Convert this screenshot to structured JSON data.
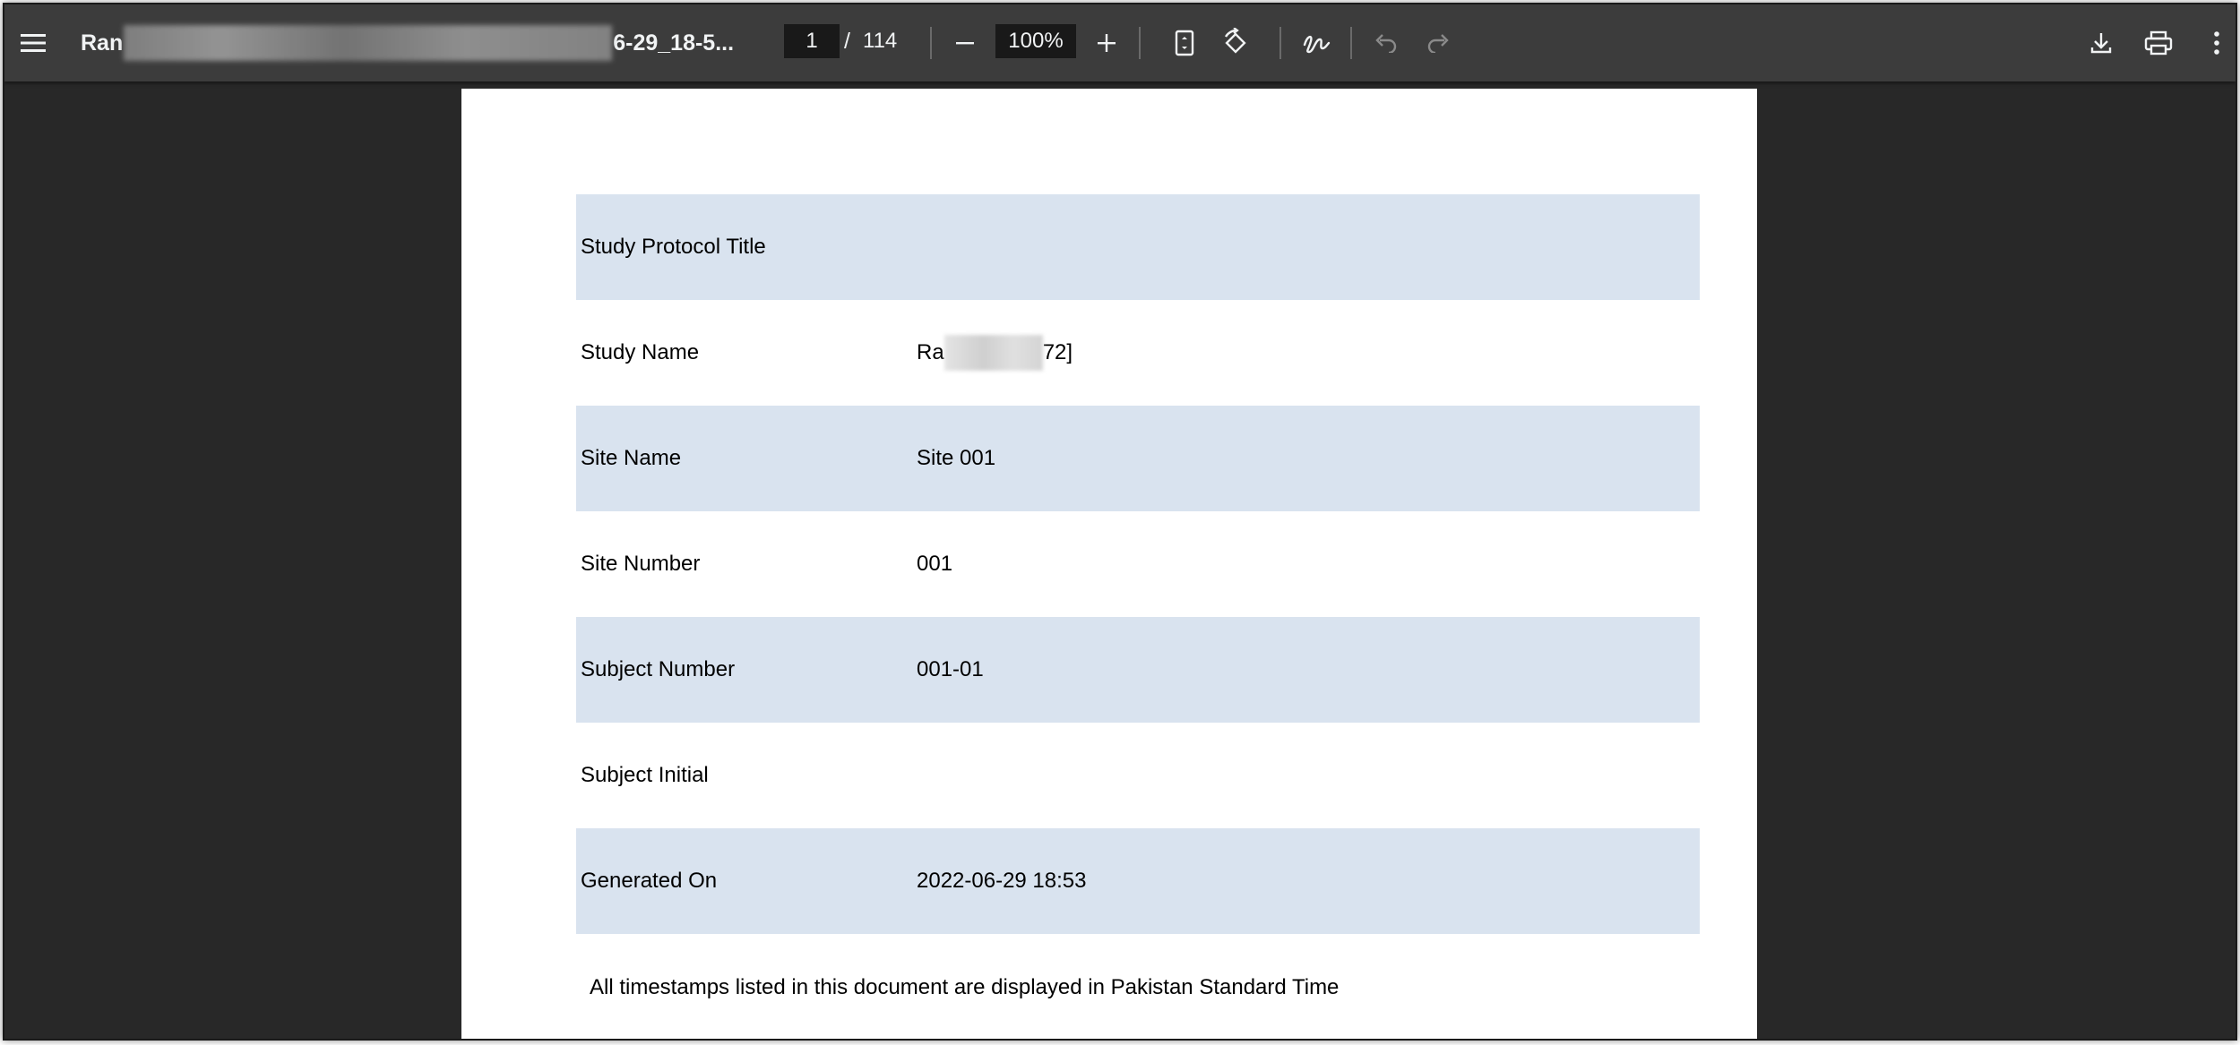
{
  "toolbar": {
    "menu_icon": "hamburger-menu-icon",
    "file_title_prefix": "Ran",
    "file_title_suffix": "6-29_18-5...",
    "current_page": "1",
    "page_separator": "/",
    "total_pages": "114",
    "zoom_out_icon": "minus-icon",
    "zoom_level": "100%",
    "zoom_in_icon": "plus-icon",
    "fit_page_icon": "fit-to-page-icon",
    "rotate_icon": "rotate-icon",
    "annotate_icon": "draw-annotation-icon",
    "undo_icon": "undo-icon",
    "redo_icon": "redo-icon",
    "download_icon": "download-icon",
    "print_icon": "print-icon",
    "more_icon": "more-vertical-icon"
  },
  "document": {
    "rows": [
      {
        "label": "Study Protocol Title",
        "value": "",
        "shaded": true
      },
      {
        "label": "Study Name",
        "value_prefix": "Ra",
        "value_suffix": "72]",
        "redacted": true,
        "shaded": false
      },
      {
        "label": "Site Name",
        "value": "Site 001",
        "shaded": true
      },
      {
        "label": "Site Number",
        "value": "001",
        "shaded": false
      },
      {
        "label": "Subject Number",
        "value": "001-01",
        "shaded": true
      },
      {
        "label": "Subject Initial",
        "value": "",
        "shaded": false
      },
      {
        "label": "Generated On",
        "value": "2022-06-29 18:53",
        "shaded": true
      }
    ],
    "footnote": "All timestamps listed in this document are displayed in Pakistan Standard Time"
  },
  "colors": {
    "toolbar_bg": "#3c3c3c",
    "viewer_bg": "#282828",
    "page_bg": "#ffffff",
    "row_shade": "#d9e3ef",
    "input_bg": "#191919",
    "icon_color": "#f1f3f4",
    "disabled_icon_color": "#8a8a8a"
  }
}
